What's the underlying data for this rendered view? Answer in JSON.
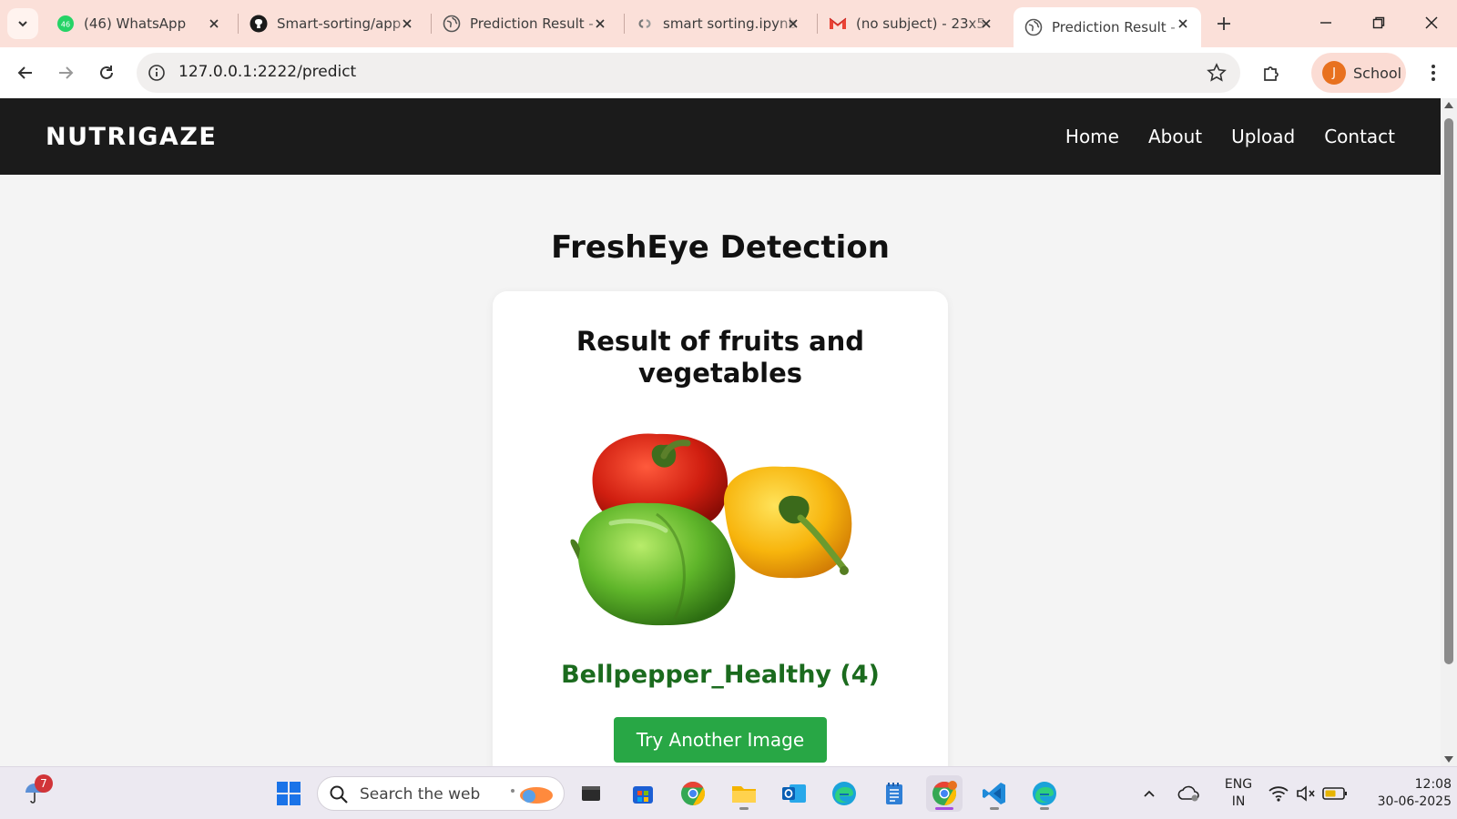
{
  "browser": {
    "tabs": [
      {
        "title": "(46) WhatsApp",
        "icon": "whatsapp-icon",
        "badge": "46"
      },
      {
        "title": "Smart-sorting/app",
        "icon": "github-icon"
      },
      {
        "title": "Prediction Result -",
        "icon": "globe-icon"
      },
      {
        "title": "smart sorting.ipynb",
        "icon": "colab-icon"
      },
      {
        "title": "(no subject) - 23x5",
        "icon": "gmail-icon"
      },
      {
        "title": "Prediction Result -",
        "icon": "globe-icon",
        "active": true
      }
    ],
    "url": "127.0.0.1:2222/predict",
    "profile": {
      "initial": "J",
      "label": "School"
    }
  },
  "site": {
    "brand": "NUTRIGAZE",
    "nav": [
      "Home",
      "About",
      "Upload",
      "Contact"
    ],
    "page_title": "FreshEye Detection",
    "card": {
      "title": "Result of fruits and vegetables",
      "image": "bell-peppers-image",
      "result": "Bellpepper_Healthy (4)",
      "button": "Try Another Image",
      "result_color": "#1b6b1e",
      "button_color": "#28a745"
    }
  },
  "taskbar": {
    "weather_badge": "7",
    "search_placeholder": "Search the web",
    "lang_line1": "ENG",
    "lang_line2": "IN",
    "time": "12:08",
    "date": "30-06-2025"
  }
}
